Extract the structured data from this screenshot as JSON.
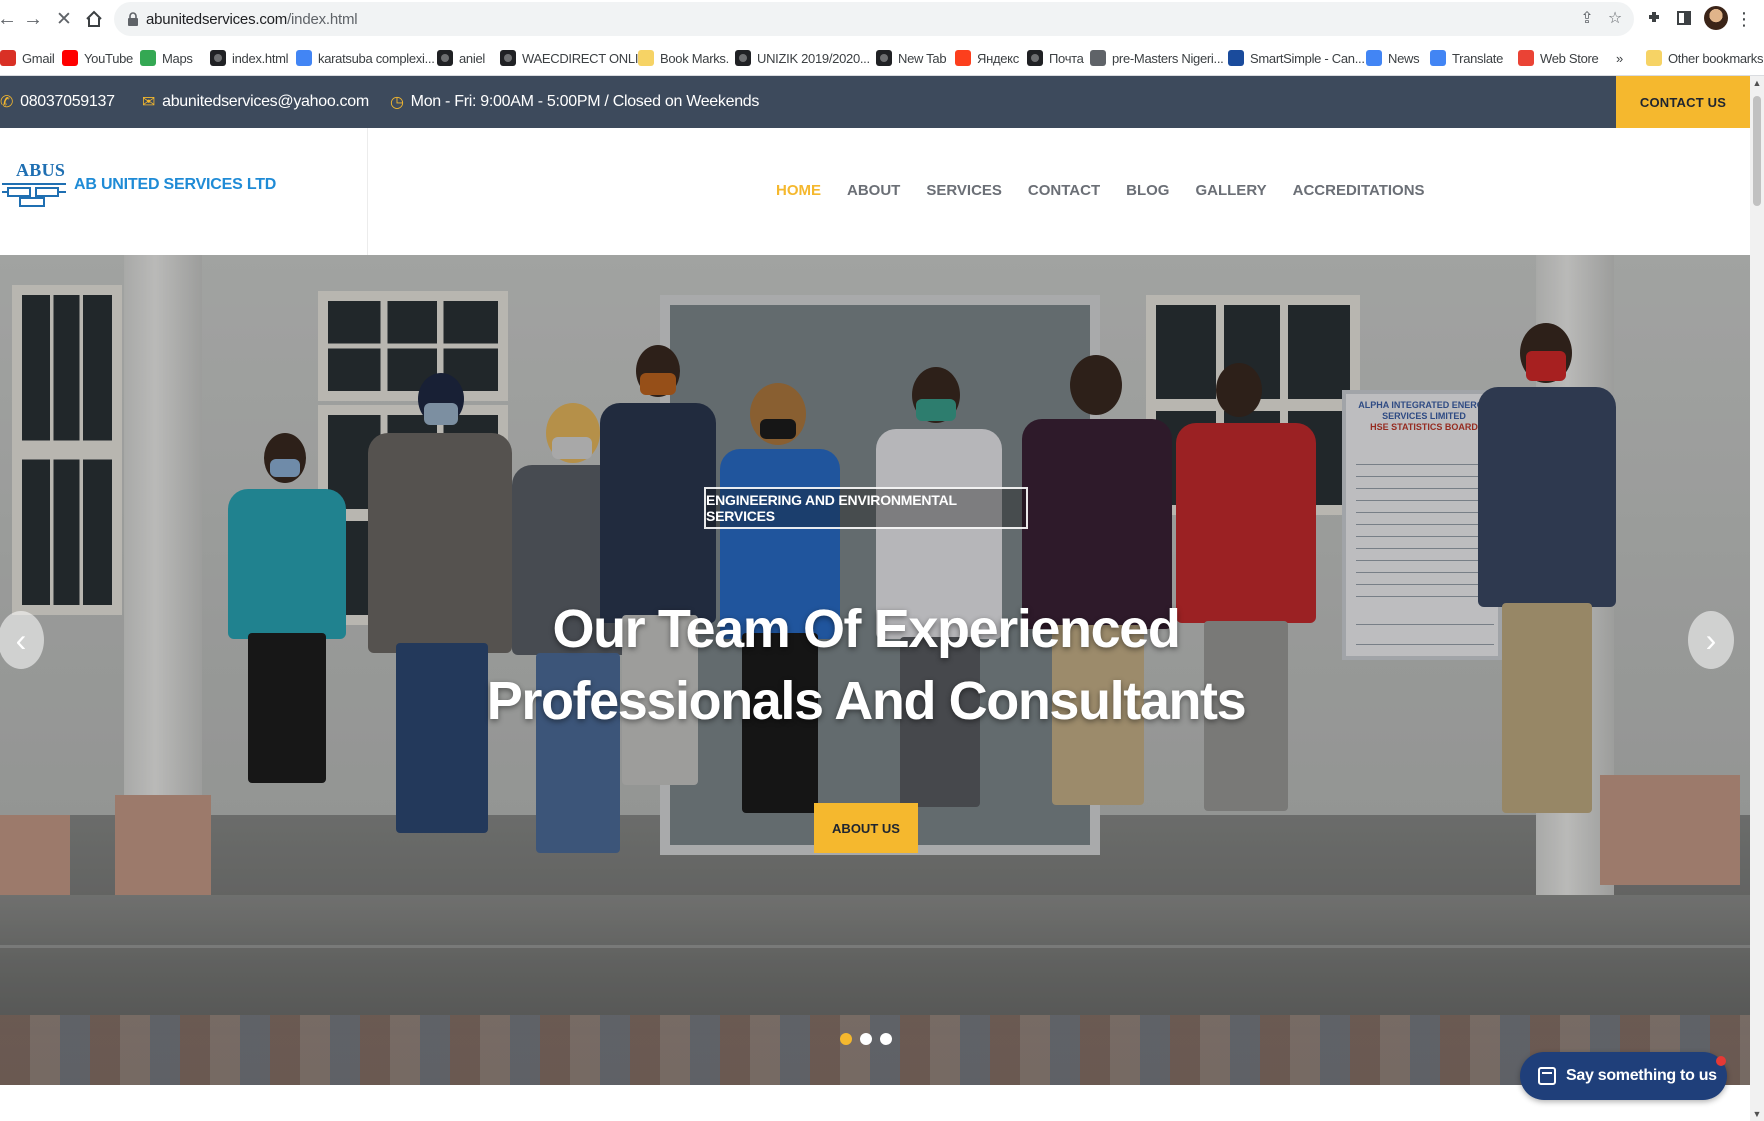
{
  "browser": {
    "url_host": "abunitedservices.com",
    "url_path": "/index.html",
    "bookmarks": [
      {
        "label": "Gmail",
        "icon": "gmail-icon",
        "color": "#d93025"
      },
      {
        "label": "YouTube",
        "icon": "youtube-icon",
        "color": "#ff0000"
      },
      {
        "label": "Maps",
        "icon": "maps-icon",
        "color": "#34a853"
      },
      {
        "label": "index.html",
        "icon": "globe-icon",
        "color": "#202124"
      },
      {
        "label": "karatsuba complexi...",
        "icon": "google-icon",
        "color": "#4285f4"
      },
      {
        "label": "aniel",
        "icon": "globe-icon",
        "color": "#202124"
      },
      {
        "label": "WAECDIRECT ONLI...",
        "icon": "globe-icon",
        "color": "#202124"
      },
      {
        "label": "Book Marks.",
        "icon": "folder-icon",
        "color": "#f6d365"
      },
      {
        "label": "UNIZIK 2019/2020...",
        "icon": "globe-icon",
        "color": "#202124"
      },
      {
        "label": "New Tab",
        "icon": "globe-icon",
        "color": "#202124"
      },
      {
        "label": "Яндекс",
        "icon": "yandex-icon",
        "color": "#fc3f1d"
      },
      {
        "label": "Почта",
        "icon": "globe-icon",
        "color": "#202124"
      },
      {
        "label": "pre-Masters Nigeri...",
        "icon": "document-icon",
        "color": "#5f6368"
      },
      {
        "label": "SmartSimple - Can...",
        "icon": "smartsimple-icon",
        "color": "#1a4b9c"
      },
      {
        "label": "News",
        "icon": "news-icon",
        "color": "#4285f4"
      },
      {
        "label": "Translate",
        "icon": "translate-icon",
        "color": "#4285f4"
      },
      {
        "label": "Web Store",
        "icon": "webstore-icon",
        "color": "#ea4335"
      }
    ],
    "more_bookmarks": "»",
    "other_bookmarks": "Other bookmarks"
  },
  "topbar": {
    "phone": "08037059137",
    "email": "abunitedservices@yahoo.com",
    "hours": "Mon - Fri: 9:00AM - 5:00PM / Closed on Weekends",
    "contact_button": "CONTACT US"
  },
  "header": {
    "logo_mark_text": "ABUS",
    "company_name": "AB UNITED SERVICES LTD",
    "nav": [
      {
        "label": "HOME",
        "active": true
      },
      {
        "label": "ABOUT",
        "active": false
      },
      {
        "label": "SERVICES",
        "active": false
      },
      {
        "label": "CONTACT",
        "active": false
      },
      {
        "label": "BLOG",
        "active": false
      },
      {
        "label": "GALLERY",
        "active": false
      },
      {
        "label": "ACCREDITATIONS",
        "active": false
      }
    ]
  },
  "hero": {
    "tagline": "ENGINEERING AND ENVIRONMENTAL SERVICES",
    "title_line1": "Our Team Of Experienced",
    "title_line2": "Professionals And Consultants",
    "button": "ABOUT US",
    "prev_arrow": "‹",
    "next_arrow": "›",
    "slides_total": 3,
    "active_slide": 1,
    "board_line1": "ALPHA INTEGRATED ENERGY",
    "board_line2": "SERVICES LIMITED",
    "board_line3": "HSE STATISTICS BOARD"
  },
  "chat_widget": {
    "label": "Say something to us"
  },
  "colors": {
    "accent": "#f5b82e",
    "topbar_bg": "#3d4a5c",
    "brand_blue": "#1f8bd6",
    "chat_bg": "#1f3f7a"
  }
}
